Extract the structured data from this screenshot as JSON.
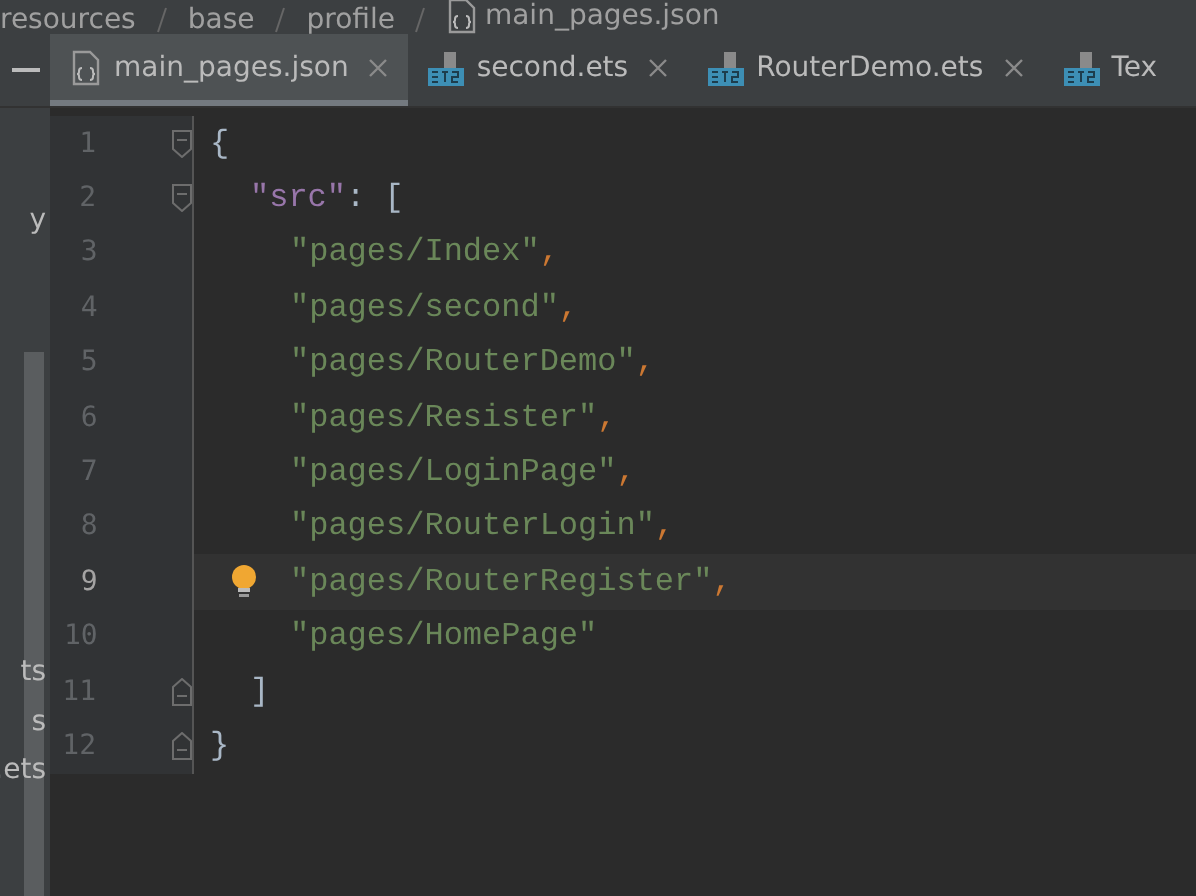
{
  "breadcrumb": [
    "resources",
    "base",
    "profile",
    "main_pages.json"
  ],
  "project_panel": {
    "items": [
      "y",
      "ts",
      "s",
      ".ets"
    ]
  },
  "tabs": [
    {
      "label": "main_pages.json",
      "kind": "json",
      "selected": true,
      "closable": true
    },
    {
      "label": "second.ets",
      "kind": "ets",
      "selected": false,
      "closable": true
    },
    {
      "label": "RouterDemo.ets",
      "kind": "ets",
      "selected": false,
      "closable": true
    },
    {
      "label": "Tex",
      "kind": "ets",
      "selected": false,
      "closable": false
    }
  ],
  "editor": {
    "lines": [
      {
        "number": "1",
        "fold_start": true,
        "current": false,
        "hint": false,
        "tokens": [
          {
            "kind": "brace",
            "text": "{"
          }
        ],
        "children": [
          {
            "number": "2",
            "fold_start": true,
            "current": false,
            "hint": false,
            "tokens": [
              {
                "kind": "key",
                "text": "\"src\""
              },
              {
                "kind": "colon",
                "text": ": "
              },
              {
                "kind": "brace",
                "text": "["
              }
            ],
            "children": [
              {
                "number": "3",
                "current": false,
                "hint": false,
                "tokens": [
                  {
                    "kind": "string",
                    "text": "\"pages/Index\""
                  },
                  {
                    "kind": "comma",
                    "text": ","
                  }
                ]
              },
              {
                "number": "4",
                "current": false,
                "hint": false,
                "tokens": [
                  {
                    "kind": "string",
                    "text": "\"pages/second\""
                  },
                  {
                    "kind": "comma",
                    "text": ","
                  }
                ]
              },
              {
                "number": "5",
                "current": false,
                "hint": false,
                "tokens": [
                  {
                    "kind": "string",
                    "text": "\"pages/RouterDemo\""
                  },
                  {
                    "kind": "comma",
                    "text": ","
                  }
                ]
              },
              {
                "number": "6",
                "current": false,
                "hint": false,
                "tokens": [
                  {
                    "kind": "string",
                    "text": "\"pages/Resister\""
                  },
                  {
                    "kind": "comma",
                    "text": ","
                  }
                ]
              },
              {
                "number": "7",
                "current": false,
                "hint": false,
                "tokens": [
                  {
                    "kind": "string",
                    "text": "\"pages/LoginPage\""
                  },
                  {
                    "kind": "comma",
                    "text": ","
                  }
                ]
              },
              {
                "number": "8",
                "current": false,
                "hint": false,
                "tokens": [
                  {
                    "kind": "string",
                    "text": "\"pages/RouterLogin\""
                  },
                  {
                    "kind": "comma",
                    "text": ","
                  }
                ]
              },
              {
                "number": "9",
                "current": true,
                "hint": true,
                "tokens": [
                  {
                    "kind": "string",
                    "text": "\"pages/RouterRegister\""
                  },
                  {
                    "kind": "comma",
                    "text": ","
                  }
                ]
              },
              {
                "number": "10",
                "current": false,
                "hint": false,
                "tokens": [
                  {
                    "kind": "string",
                    "text": "\"pages/HomePage\""
                  }
                ]
              }
            ]
          },
          {
            "number": "11",
            "fold_end": true,
            "current": false,
            "hint": false,
            "tokens": [
              {
                "kind": "brace",
                "text": "]"
              }
            ]
          }
        ]
      },
      {
        "number": "12",
        "fold_end": true,
        "current": false,
        "hint": false,
        "tokens": [
          {
            "kind": "brace",
            "text": "}"
          }
        ]
      }
    ]
  }
}
